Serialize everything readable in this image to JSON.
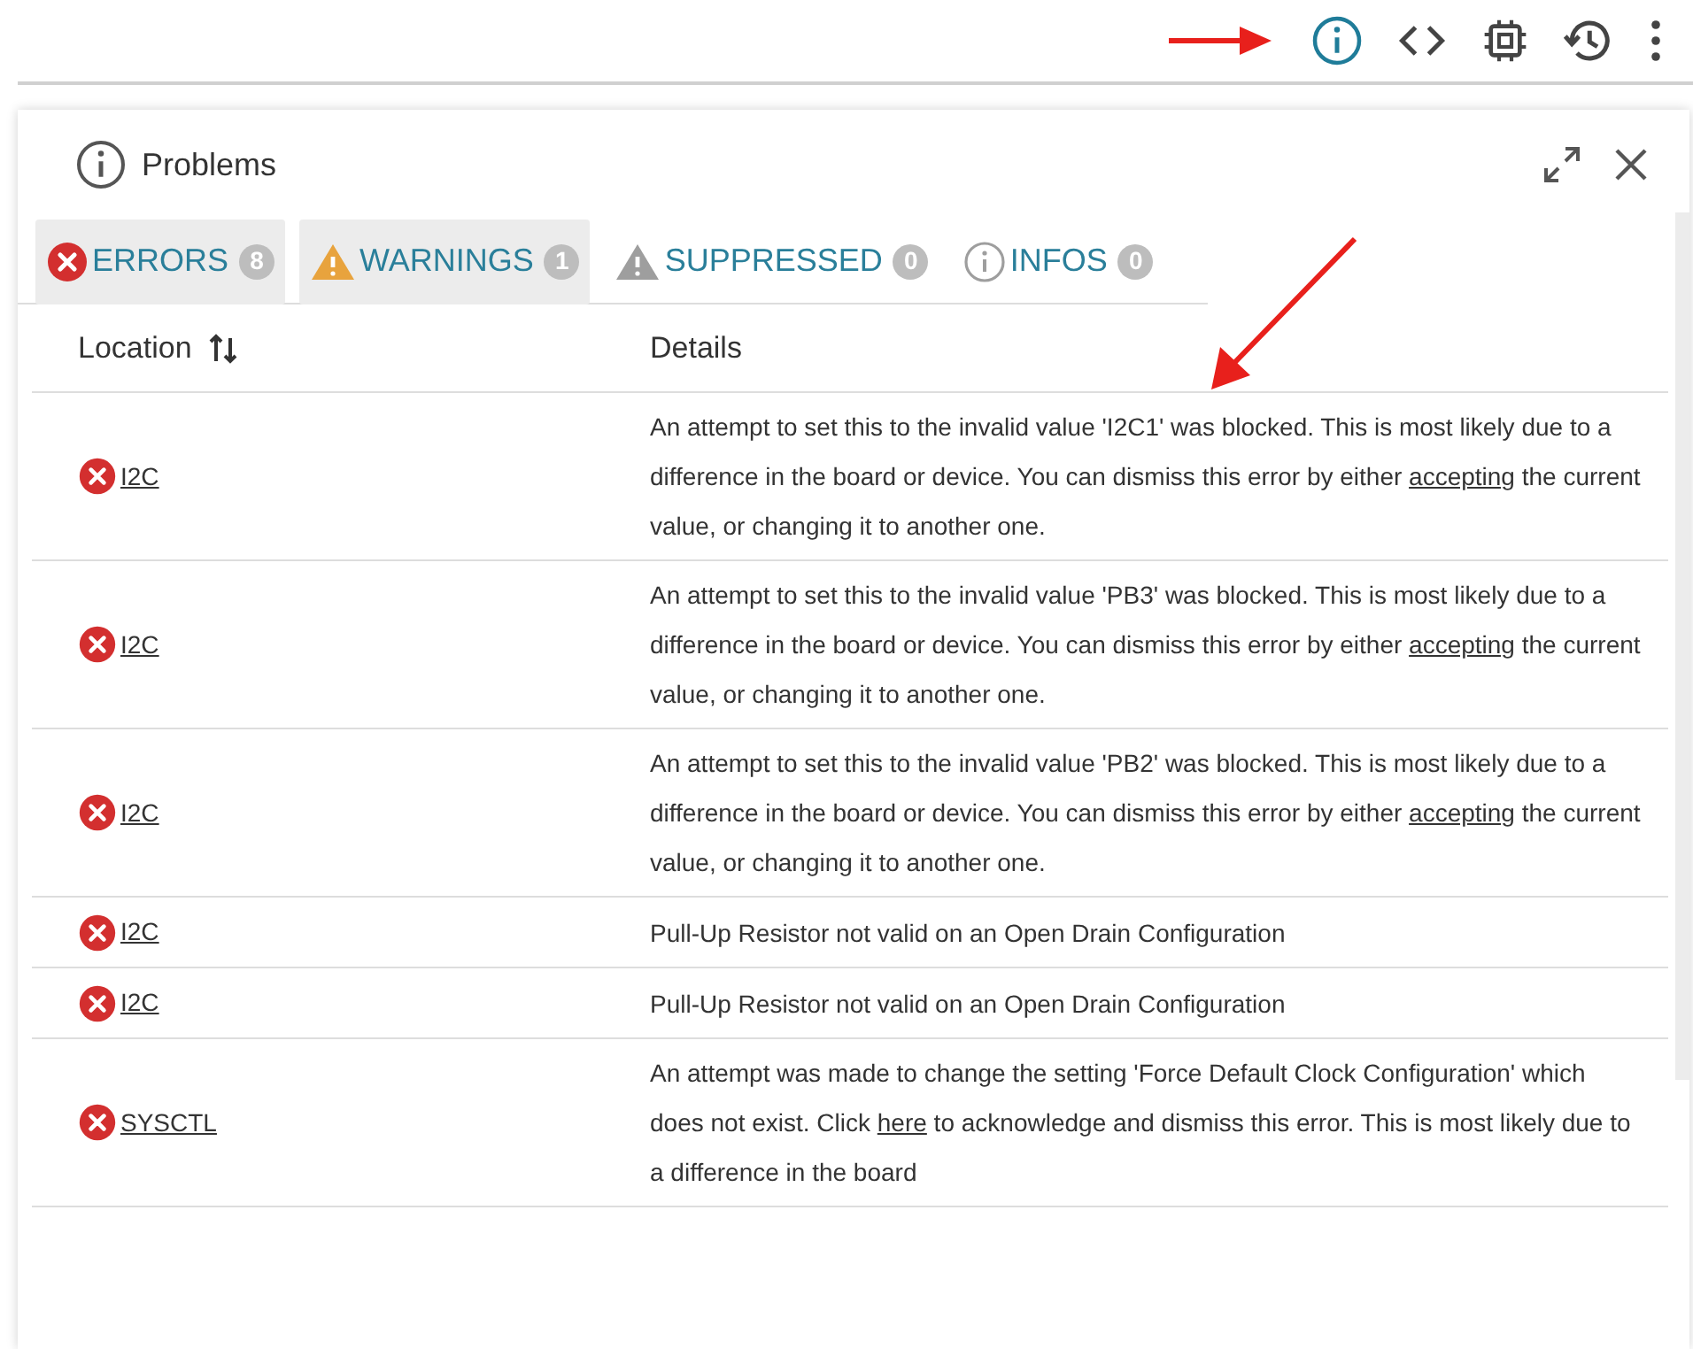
{
  "toolbar": {
    "buttons": [
      {
        "kind": "info",
        "selected": true
      },
      {
        "kind": "code",
        "selected": false
      },
      {
        "kind": "chip",
        "selected": false
      },
      {
        "kind": "history",
        "selected": false
      },
      {
        "kind": "more",
        "selected": false
      }
    ]
  },
  "panel": {
    "title": "Problems",
    "tabs": [
      {
        "kind": "error",
        "label": "ERRORS",
        "count": "8",
        "selected": true
      },
      {
        "kind": "warning",
        "label": "WARNINGS",
        "count": "1",
        "selected": true
      },
      {
        "kind": "suppressed",
        "label": "SUPPRESSED",
        "count": "0",
        "selected": false
      },
      {
        "kind": "info",
        "label": "INFOS",
        "count": "0",
        "selected": false
      }
    ],
    "table": {
      "columns": [
        "Location",
        "Details"
      ],
      "rows": [
        {
          "location": "I2C",
          "details": [
            {
              "kind": "text",
              "text": "An attempt to set this to the invalid value 'I2C1' was blocked. This is most likely due to a difference in the board or device. You can dismiss this error by either "
            },
            {
              "kind": "link",
              "text": "accepting"
            },
            {
              "kind": "text",
              "text": " the current value, or changing it to another one."
            }
          ]
        },
        {
          "location": "I2C",
          "details": [
            {
              "kind": "text",
              "text": "An attempt to set this to the invalid value 'PB3' was blocked. This is most likely due to a difference in the board or device. You can dismiss this error by either "
            },
            {
              "kind": "link",
              "text": "accepting"
            },
            {
              "kind": "text",
              "text": " the current value, or changing it to another one."
            }
          ]
        },
        {
          "location": "I2C",
          "details": [
            {
              "kind": "text",
              "text": "An attempt to set this to the invalid value 'PB2' was blocked. This is most likely due to a difference in the board or device. You can dismiss this error by either "
            },
            {
              "kind": "link",
              "text": "accepting"
            },
            {
              "kind": "text",
              "text": " the current value, or changing it to another one."
            }
          ]
        },
        {
          "location": "I2C",
          "details": [
            {
              "kind": "text",
              "text": "Pull-Up Resistor not valid on an Open Drain Configuration"
            }
          ]
        },
        {
          "location": "I2C",
          "details": [
            {
              "kind": "text",
              "text": "Pull-Up Resistor not valid on an Open Drain Configuration"
            }
          ]
        },
        {
          "location": "SYSCTL",
          "details": [
            {
              "kind": "text",
              "text": "An attempt was made to change the setting 'Force Default Clock Configuration' which does not exist. Click "
            },
            {
              "kind": "link",
              "text": "here"
            },
            {
              "kind": "text",
              "text": " to acknowledge and dismiss this error. This is most likely due to a difference in the board"
            }
          ]
        }
      ]
    }
  }
}
